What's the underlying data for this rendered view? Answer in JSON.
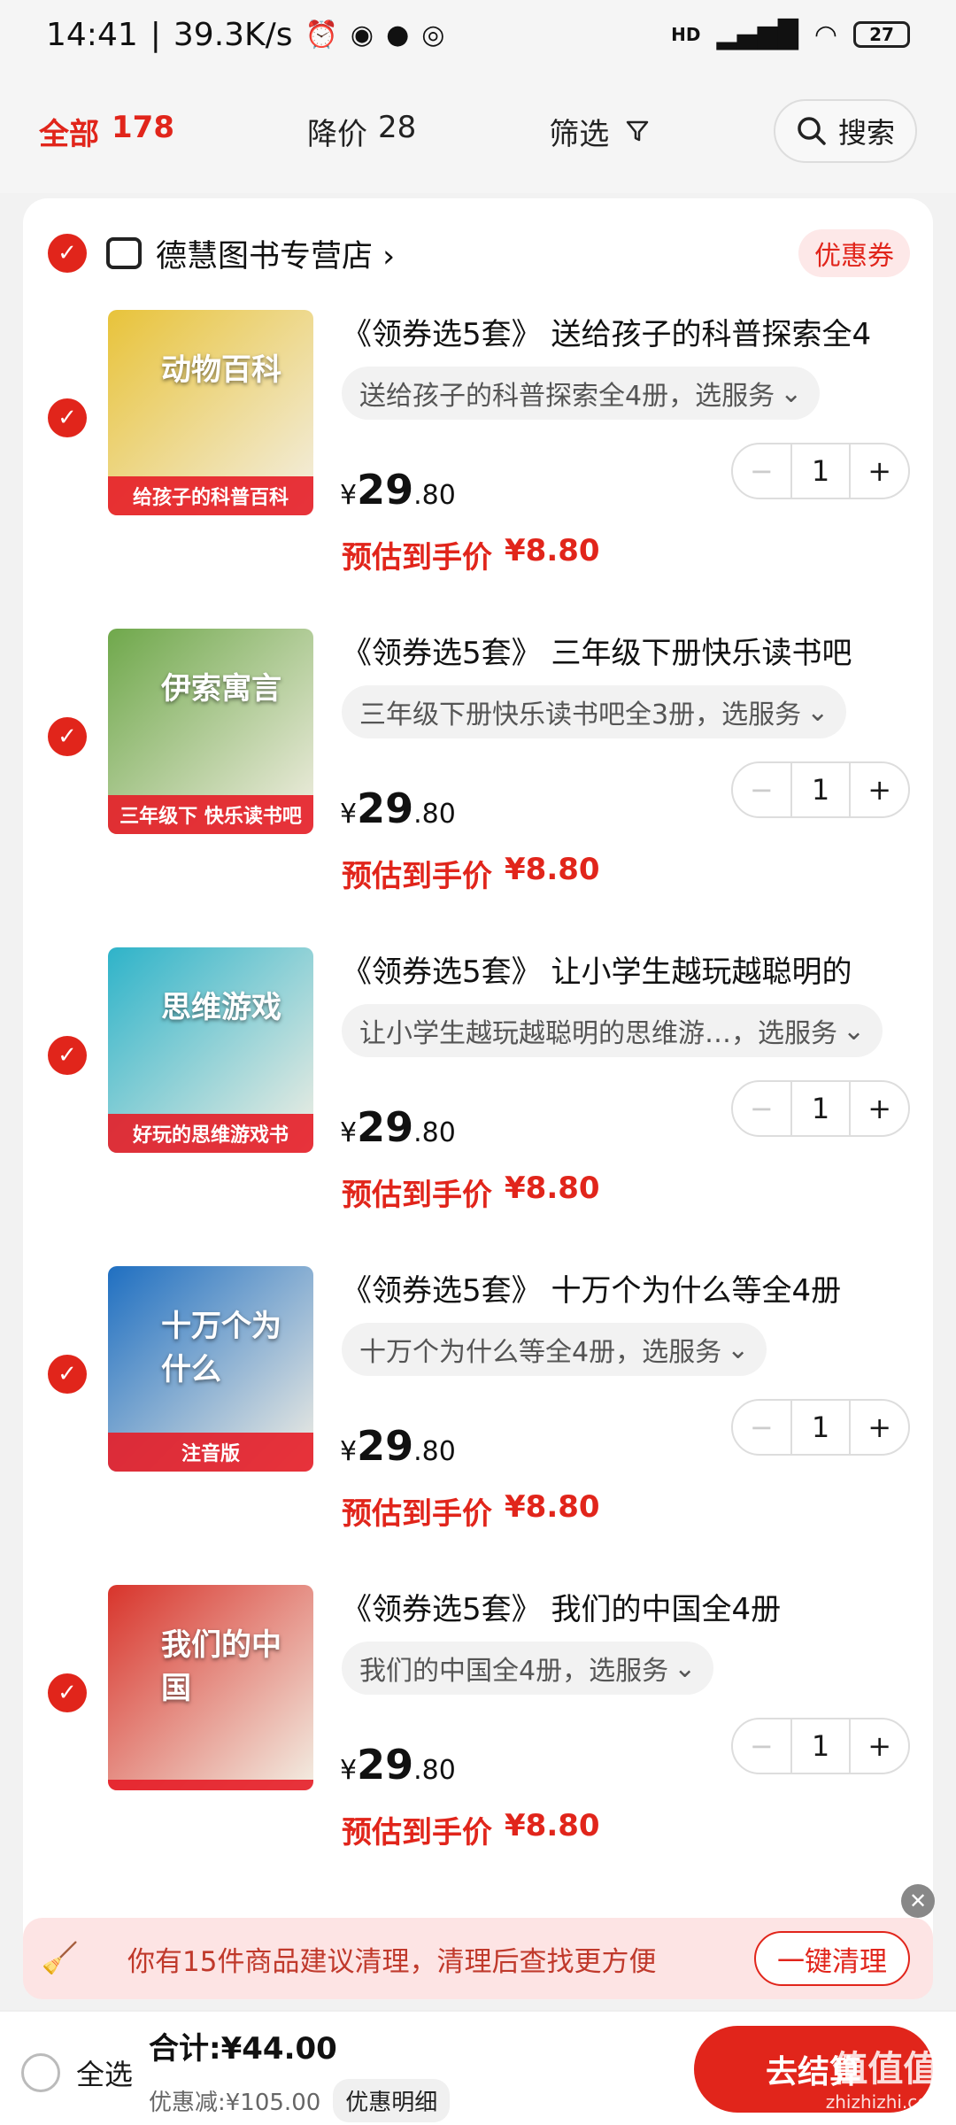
{
  "status_bar": {
    "time": "14:41",
    "speed": "39.3K/s",
    "network": "HD",
    "battery": "27"
  },
  "filters": {
    "all_label": "全部",
    "all_count": "178",
    "price_drop_label": "降价",
    "price_drop_count": "28",
    "filter_label": "筛选",
    "search_label": "搜索"
  },
  "shop": {
    "name": "德慧图书专营店",
    "coupon_label": "优惠券"
  },
  "products": [
    {
      "title": "《领券选5套》 送给孩子的科普探索全4",
      "variant": "送给孩子的科普探索全4册，选服务",
      "price_yen": "¥",
      "price_int": "29",
      "price_dec": ".80",
      "est_label": "预估到手价",
      "est_price": "¥8.80",
      "qty": "1",
      "thumb_title": "动物百科",
      "thumb_caption": "给孩子的科普百科",
      "thumb_color": "#e8c33a"
    },
    {
      "title": "《领券选5套》 三年级下册快乐读书吧",
      "variant": "三年级下册快乐读书吧全3册，选服务",
      "price_yen": "¥",
      "price_int": "29",
      "price_dec": ".80",
      "est_label": "预估到手价",
      "est_price": "¥8.80",
      "qty": "1",
      "thumb_title": "伊索寓言",
      "thumb_caption": "三年级下 快乐读书吧",
      "thumb_color": "#6fa84b"
    },
    {
      "title": "《领券选5套》 让小学生越玩越聪明的",
      "variant": "让小学生越玩越聪明的思维游…，选服务",
      "price_yen": "¥",
      "price_int": "29",
      "price_dec": ".80",
      "est_label": "预估到手价",
      "est_price": "¥8.80",
      "qty": "1",
      "thumb_title": "思维游戏",
      "thumb_caption": "好玩的思维游戏书",
      "thumb_color": "#2eb3c9"
    },
    {
      "title": "《领券选5套》 十万个为什么等全4册",
      "variant": "十万个为什么等全4册，选服务",
      "price_yen": "¥",
      "price_int": "29",
      "price_dec": ".80",
      "est_label": "预估到手价",
      "est_price": "¥8.80",
      "qty": "1",
      "thumb_title": "十万个为什么",
      "thumb_caption": "注音版",
      "thumb_color": "#1f6fc1"
    },
    {
      "title": "《领券选5套》 我们的中国全4册",
      "variant": "我们的中国全4册，选服务",
      "price_yen": "¥",
      "price_int": "29",
      "price_dec": ".80",
      "est_label": "预估到手价",
      "est_price": "¥8.80",
      "qty": "1",
      "thumb_title": "我们的中国",
      "thumb_caption": "",
      "thumb_color": "#d8342b"
    }
  ],
  "cleanup": {
    "text": "你有15件商品建议清理，清理后查找更方便",
    "button": "一键清理"
  },
  "bottom": {
    "select_all": "全选",
    "total": "合计:¥44.00",
    "discount_text": "优惠减:¥105.00",
    "detail_button": "优惠明细",
    "checkout": "去结算"
  },
  "watermark": {
    "main": "值值值",
    "sub": "zhizhizhi.com"
  }
}
